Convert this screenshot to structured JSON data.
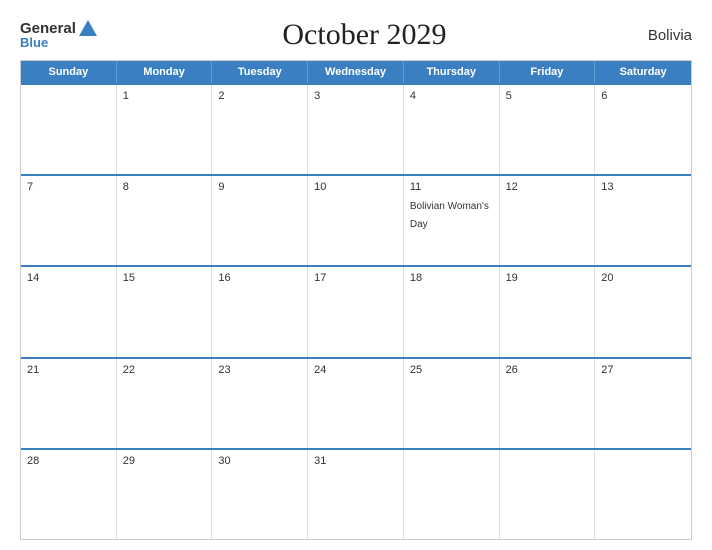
{
  "header": {
    "logo_general": "General",
    "logo_blue": "Blue",
    "title": "October 2029",
    "country": "Bolivia"
  },
  "weekdays": [
    "Sunday",
    "Monday",
    "Tuesday",
    "Wednesday",
    "Thursday",
    "Friday",
    "Saturday"
  ],
  "weeks": [
    [
      {
        "day": "",
        "shaded": false,
        "event": ""
      },
      {
        "day": "1",
        "shaded": false,
        "event": ""
      },
      {
        "day": "2",
        "shaded": false,
        "event": ""
      },
      {
        "day": "3",
        "shaded": false,
        "event": ""
      },
      {
        "day": "4",
        "shaded": false,
        "event": ""
      },
      {
        "day": "5",
        "shaded": false,
        "event": ""
      },
      {
        "day": "6",
        "shaded": false,
        "event": ""
      }
    ],
    [
      {
        "day": "7",
        "shaded": false,
        "event": ""
      },
      {
        "day": "8",
        "shaded": false,
        "event": ""
      },
      {
        "day": "9",
        "shaded": false,
        "event": ""
      },
      {
        "day": "10",
        "shaded": false,
        "event": ""
      },
      {
        "day": "11",
        "shaded": false,
        "event": "Bolivian Woman's Day"
      },
      {
        "day": "12",
        "shaded": false,
        "event": ""
      },
      {
        "day": "13",
        "shaded": false,
        "event": ""
      }
    ],
    [
      {
        "day": "14",
        "shaded": false,
        "event": ""
      },
      {
        "day": "15",
        "shaded": false,
        "event": ""
      },
      {
        "day": "16",
        "shaded": false,
        "event": ""
      },
      {
        "day": "17",
        "shaded": false,
        "event": ""
      },
      {
        "day": "18",
        "shaded": false,
        "event": ""
      },
      {
        "day": "19",
        "shaded": false,
        "event": ""
      },
      {
        "day": "20",
        "shaded": false,
        "event": ""
      }
    ],
    [
      {
        "day": "21",
        "shaded": false,
        "event": ""
      },
      {
        "day": "22",
        "shaded": false,
        "event": ""
      },
      {
        "day": "23",
        "shaded": false,
        "event": ""
      },
      {
        "day": "24",
        "shaded": false,
        "event": ""
      },
      {
        "day": "25",
        "shaded": false,
        "event": ""
      },
      {
        "day": "26",
        "shaded": false,
        "event": ""
      },
      {
        "day": "27",
        "shaded": false,
        "event": ""
      }
    ],
    [
      {
        "day": "28",
        "shaded": false,
        "event": ""
      },
      {
        "day": "29",
        "shaded": false,
        "event": ""
      },
      {
        "day": "30",
        "shaded": false,
        "event": ""
      },
      {
        "day": "31",
        "shaded": false,
        "event": ""
      },
      {
        "day": "",
        "shaded": false,
        "event": ""
      },
      {
        "day": "",
        "shaded": false,
        "event": ""
      },
      {
        "day": "",
        "shaded": false,
        "event": ""
      }
    ]
  ]
}
